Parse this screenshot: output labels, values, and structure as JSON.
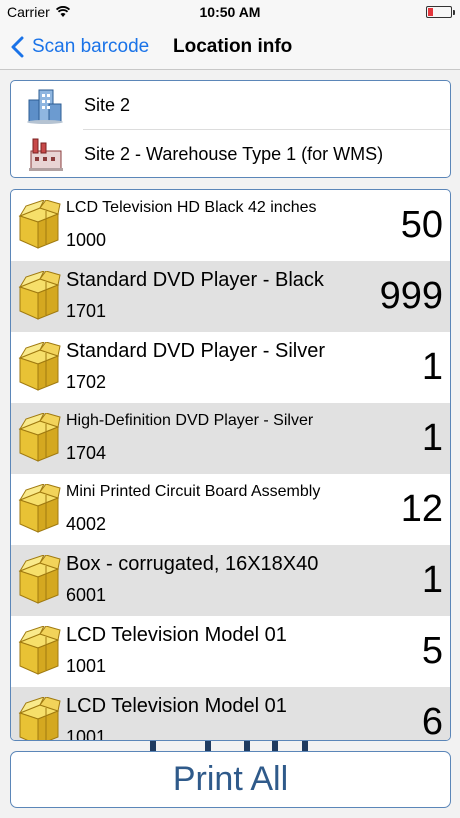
{
  "status": {
    "carrier": "Carrier",
    "time": "10:50 AM"
  },
  "nav": {
    "back_label": "Scan barcode",
    "title": "Location info"
  },
  "location": {
    "site": "Site 2",
    "warehouse": "Site 2 - Warehouse Type 1 (for WMS)"
  },
  "items": [
    {
      "name": "LCD Television HD Black 42 inches",
      "code": "1000",
      "qty": "50"
    },
    {
      "name": "Standard DVD Player - Black",
      "code": "1701",
      "qty": "999"
    },
    {
      "name": "Standard DVD Player - Silver",
      "code": "1702",
      "qty": "1"
    },
    {
      "name": "High-Definition DVD Player - Silver",
      "code": "1704",
      "qty": "1"
    },
    {
      "name": "Mini Printed Circuit Board Assembly",
      "code": "4002",
      "qty": "12"
    },
    {
      "name": "Box - corrugated, 16X18X40",
      "code": "6001",
      "qty": "1"
    },
    {
      "name": "LCD Television Model 01",
      "code": "1001",
      "qty": "5"
    },
    {
      "name": "LCD Television Model 01",
      "code": "1001",
      "qty": "6"
    }
  ],
  "actions": {
    "print_all": "Print All"
  },
  "colors": {
    "accent": "#1a73e8",
    "border": "#5b86b8",
    "row_alt": "#e1e1e1"
  },
  "icons": {
    "site": "building-icon",
    "warehouse": "factory-icon",
    "item": "box-icon"
  }
}
